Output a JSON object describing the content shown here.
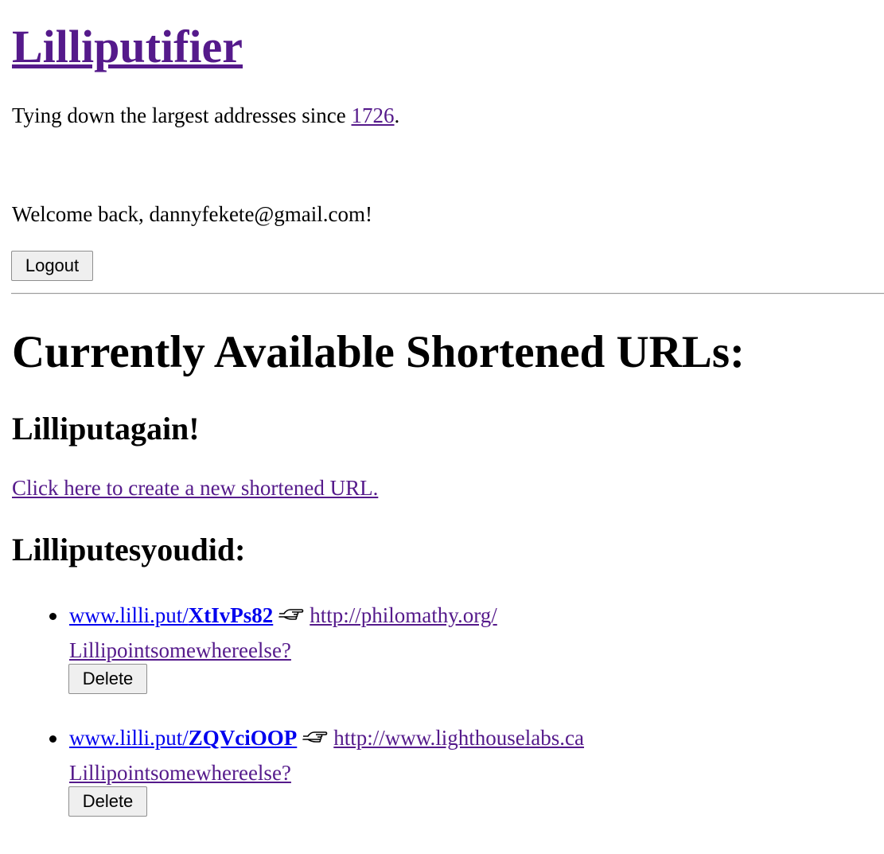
{
  "header": {
    "site_title": "Lilliputifier",
    "tagline_prefix": "Tying down the largest addresses since ",
    "tagline_year_link": "1726",
    "tagline_suffix": "."
  },
  "user": {
    "welcome_text": "Welcome back, dannyfekete@gmail.com!",
    "logout_label": "Logout"
  },
  "main": {
    "section_title": "Currently Available Shortened URLs:",
    "create_heading": "Lilliputagain!",
    "create_link": "Click here to create a new shortened URL.",
    "list_heading": "Lilliputesyoudid:"
  },
  "urls": [
    {
      "short_prefix": "www.lilli.put/",
      "short_code": "XtIvPs82",
      "pointer_icon": "pointing-hand-icon",
      "long_url": "http://philomathy.org/",
      "repoint_label": "Lillipointsomewhereelse?",
      "delete_label": "Delete"
    },
    {
      "short_prefix": "www.lilli.put/",
      "short_code": "ZQVciOOP",
      "pointer_icon": "pointing-hand-icon",
      "long_url": "http://www.lighthouselabs.ca",
      "repoint_label": "Lillipointsomewhereelse?",
      "delete_label": "Delete"
    }
  ],
  "colors": {
    "visited_link": "#551a8b",
    "unvisited_link": "#0000ee",
    "button_bg": "#efefef"
  }
}
